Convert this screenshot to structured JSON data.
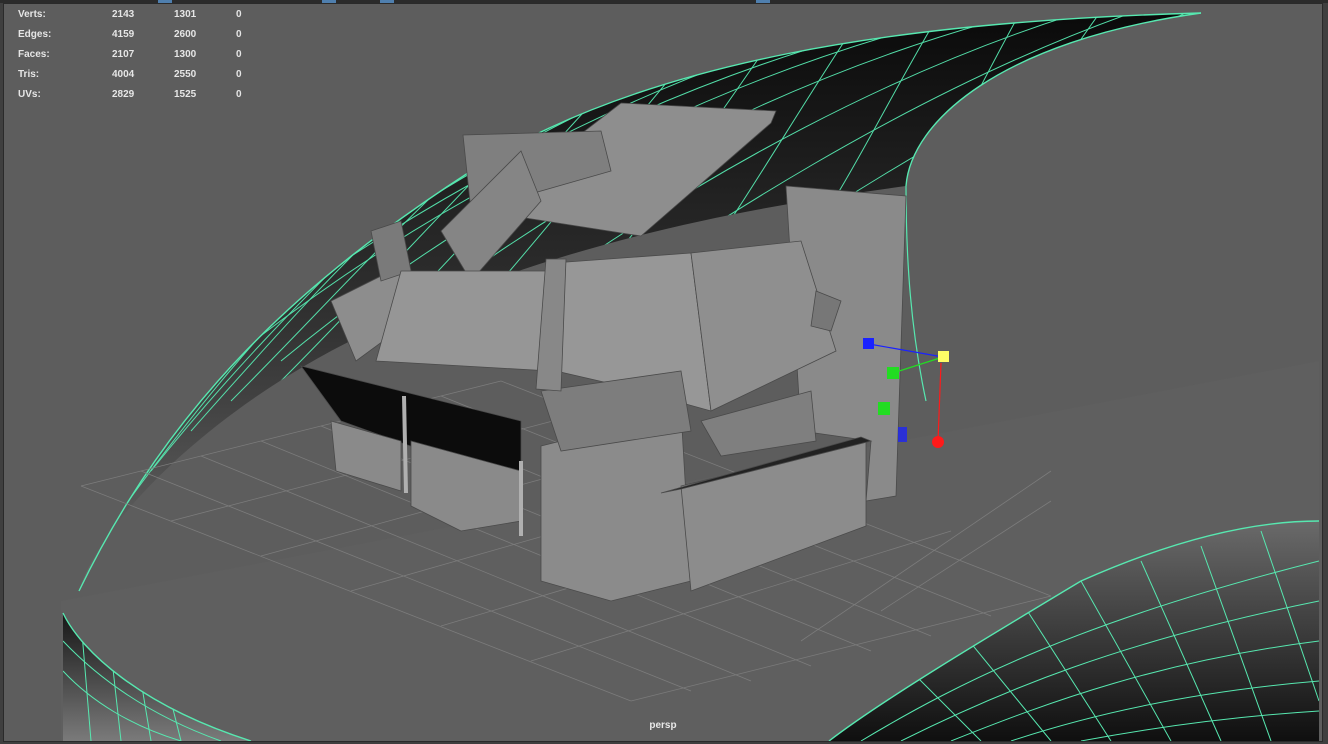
{
  "heads_up_display": {
    "stats": [
      {
        "label": "Verts:",
        "values": [
          "2143",
          "1301",
          "0"
        ]
      },
      {
        "label": "Edges:",
        "values": [
          "4159",
          "2600",
          "0"
        ]
      },
      {
        "label": "Faces:",
        "values": [
          "2107",
          "1300",
          "0"
        ]
      },
      {
        "label": "Tris:",
        "values": [
          "4004",
          "2550",
          "0"
        ]
      },
      {
        "label": "UVs:",
        "values": [
          "2829",
          "1525",
          "0"
        ]
      }
    ]
  },
  "viewport": {
    "camera_label": "persp",
    "background_color": "#5d5d5d",
    "wireframe_color": "#57e8b0",
    "grid_color": "#7a7a7a"
  },
  "manipulator": {
    "axis_x_color": "#ff1a1a",
    "axis_y_color": "#22dd22",
    "axis_z_color": "#1a22ff",
    "center_color": "#ffff66"
  }
}
